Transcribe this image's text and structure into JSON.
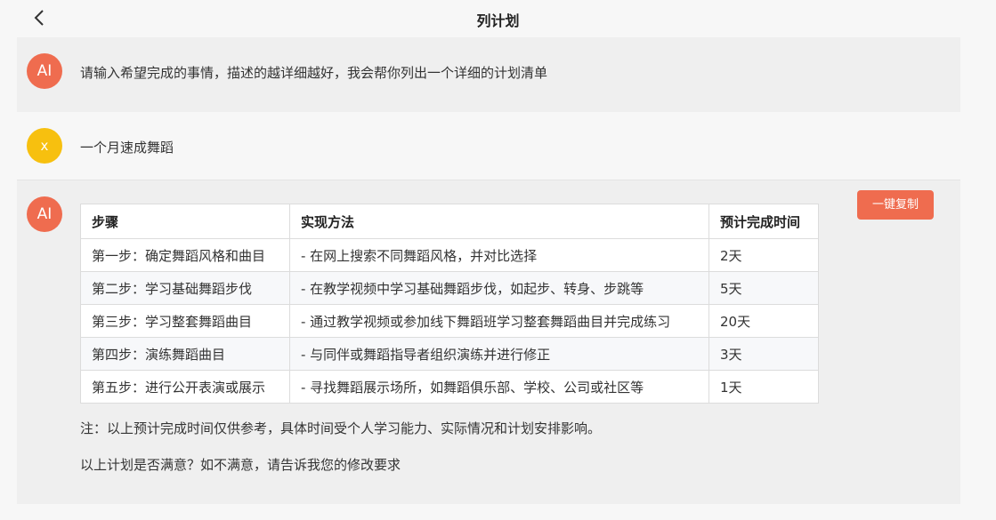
{
  "header": {
    "title": "列计划",
    "back_icon": "chevron-left-icon"
  },
  "messages": {
    "ai_intro": {
      "avatar": "AI",
      "text": "请输入希望完成的事情，描述的越详细越好，我会帮你列出一个详细的计划清单"
    },
    "user": {
      "avatar": "x",
      "text": "一个月速成舞蹈"
    },
    "ai_reply": {
      "avatar": "AI",
      "copy_label": "一键复制",
      "table": {
        "headers": [
          "步骤",
          "实现方法",
          "预计完成时间"
        ],
        "rows": [
          [
            "第一步：确定舞蹈风格和曲目",
            "- 在网上搜索不同舞蹈风格，并对比选择",
            "2天"
          ],
          [
            "第二步：学习基础舞蹈步伐",
            "- 在教学视频中学习基础舞蹈步伐，如起步、转身、步跳等",
            "5天"
          ],
          [
            "第三步：学习整套舞蹈曲目",
            "- 通过教学视频或参加线下舞蹈班学习整套舞蹈曲目并完成练习",
            "20天"
          ],
          [
            "第四步：演练舞蹈曲目",
            "- 与同伴或舞蹈指导者组织演练并进行修正",
            "3天"
          ],
          [
            "第五步：进行公开表演或展示",
            "- 寻找舞蹈展示场所，如舞蹈俱乐部、学校、公司或社区等",
            "1天"
          ]
        ]
      },
      "note": "注：以上预计完成时间仅供参考，具体时间受个人学习能力、实际情况和计划安排影响。",
      "question": "以上计划是否满意？如不满意，请告诉我您的修改要求"
    }
  },
  "colors": {
    "accent": "#ef6c4f",
    "user_avatar": "#f7c00f",
    "ai_bubble_bg": "#efefef",
    "page_bg": "#f7f7f7"
  }
}
